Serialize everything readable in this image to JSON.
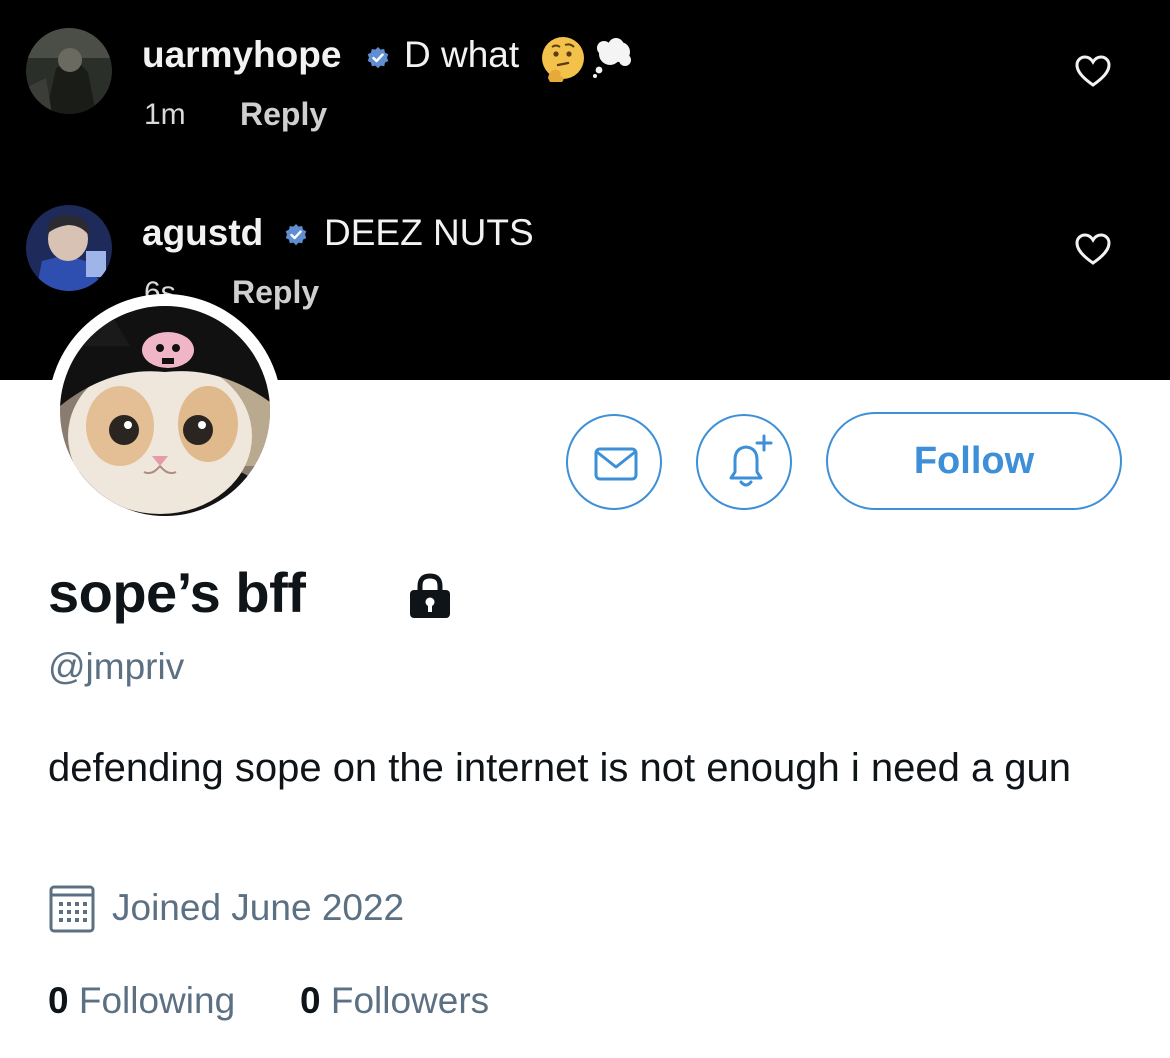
{
  "banner": {
    "comments": [
      {
        "username": "uarmyhope",
        "verified": true,
        "text": "D what",
        "emoji": [
          "thinking-face-emoji",
          "thought-balloon-emoji"
        ],
        "time": "1m",
        "reply_label": "Reply"
      },
      {
        "username": "agustd",
        "verified": true,
        "text": "DEEZ NUTS",
        "time": "6s",
        "reply_label": "Reply"
      }
    ]
  },
  "profile": {
    "display_name": "sope’s bff",
    "protected": true,
    "handle": "@jmpriv",
    "bio": "defending sope on the internet is not enough i need a gun",
    "joined": "Joined June 2022",
    "following_count": "0",
    "following_label": "Following",
    "followers_count": "0",
    "followers_label": "Followers",
    "follow_button_label": "Follow"
  },
  "colors": {
    "accent": "#3d8fd8",
    "secondary_text": "#5b7083",
    "primary_text": "#0f1419",
    "banner_bg": "#000000"
  }
}
